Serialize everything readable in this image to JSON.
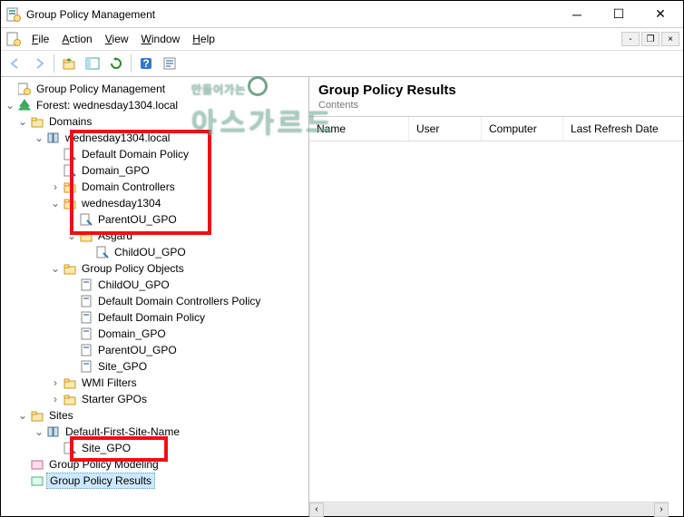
{
  "window": {
    "title": "Group Policy Management"
  },
  "menus": {
    "file": "File",
    "action": "Action",
    "view": "View",
    "window": "Window",
    "help": "Help"
  },
  "right": {
    "title": "Group Policy Results",
    "subtitle": "Contents",
    "cols": {
      "name": "Name",
      "user": "User",
      "computer": "Computer",
      "lastRefresh": "Last Refresh Date"
    }
  },
  "tree": {
    "root": "Group Policy Management",
    "forest": "Forest: wednesday1304.local",
    "domains": "Domains",
    "domain": "wednesday1304.local",
    "defaultDomainPolicy": "Default Domain Policy",
    "domainGPO": "Domain_GPO",
    "domainControllers": "Domain Controllers",
    "ou1": "wednesday1304",
    "parentOUGPO": "ParentOU_GPO",
    "ou2": "Asgard",
    "childOUGPO": "ChildOU_GPO",
    "gpoContainer": "Group Policy Objects",
    "gpo_childOU": "ChildOU_GPO",
    "gpo_defDC": "Default Domain Controllers Policy",
    "gpo_defDom": "Default Domain Policy",
    "gpo_domain": "Domain_GPO",
    "gpo_parentOU": "ParentOU_GPO",
    "gpo_site": "Site_GPO",
    "wmi": "WMI Filters",
    "starter": "Starter GPOs",
    "sites": "Sites",
    "siteName": "Default-First-Site-Name",
    "siteGPO": "Site_GPO",
    "modeling": "Group Policy Modeling",
    "results": "Group Policy Results"
  },
  "watermark": {
    "line1": "만들어가는",
    "line2": "아스가르드"
  }
}
